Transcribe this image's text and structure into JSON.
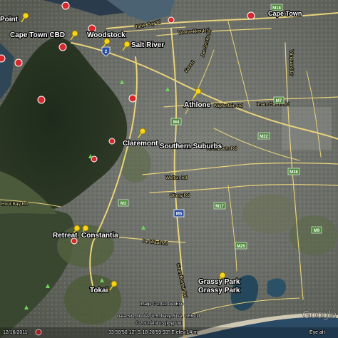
{
  "places": {
    "point": "Point",
    "cbd": "Cape Town CBD",
    "woodstock": "Woodstock",
    "salt_river": "Salt River",
    "athlone": "Athlone",
    "claremont": "Claremont",
    "southern_suburbs": "Southern Suburbs",
    "retreat": "Retreat",
    "constantia": "Constantia",
    "tokai": "Tokai",
    "grassy_park_1": "Grassy Park",
    "grassy_park_2": "Grassy Park",
    "cape_town": "Cape Town"
  },
  "roads": {
    "table_bay": "Table Bay Bl",
    "voortrekker": "Voortrekker Rd",
    "forest": "Forest",
    "klipfontein": "Klipfontein Rd",
    "wetton": "Wetton Rd",
    "ottery": "Ottery Rd",
    "de_waal": "De Waal Rd",
    "hout_bay": "Hout Bay Rd",
    "imam_haron": "Imam Haron Rd",
    "vanguard": "Vanguard Dr",
    "kromboom": "Kromboom Rd",
    "jan_smuts": "Jan Smuts Dr",
    "strandfontein": "Strandfontein Rd"
  },
  "shields": {
    "n2": "2",
    "m5": "M5",
    "m3": "M3",
    "m4": "M4",
    "m7": "M7",
    "m17": "M17",
    "m18": "M18",
    "m22": "M22",
    "m38": "M38",
    "m25": "M25",
    "m9": "M9"
  },
  "attribution": {
    "line1": "Image © 2012 GeoEye",
    "line2": "Data SIO, NOAA, U.S. Navy, NGA, GEBCO",
    "line3": "© 2012 AfriGIS (Pty) Ltd"
  },
  "status_bar": {
    "date": "12/16/2011",
    "coords": "33 59'50.12\" S  18 28'59.93\" E  elev  14 m",
    "eye_alt": "Eye alt"
  },
  "logo": "Google"
}
